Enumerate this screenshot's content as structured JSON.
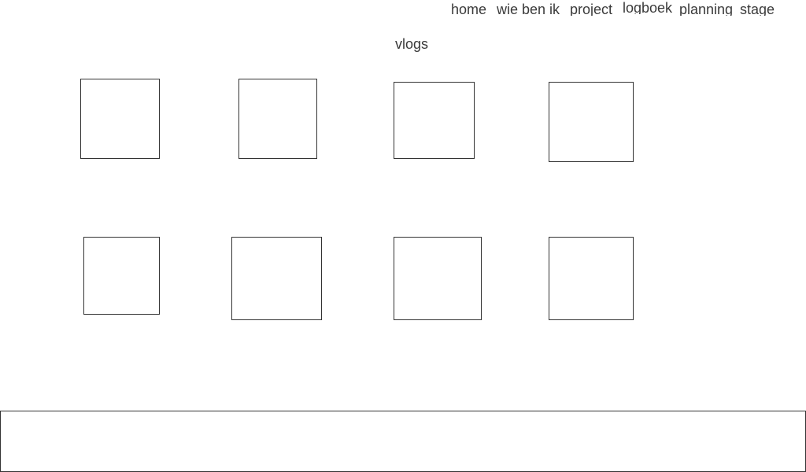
{
  "nav": {
    "home": "home",
    "wie_ben_ik": "wie ben ik",
    "project": "project",
    "logboek": "logboek",
    "planning": "planning",
    "stage": "stage"
  },
  "page": {
    "title": "vlogs"
  }
}
